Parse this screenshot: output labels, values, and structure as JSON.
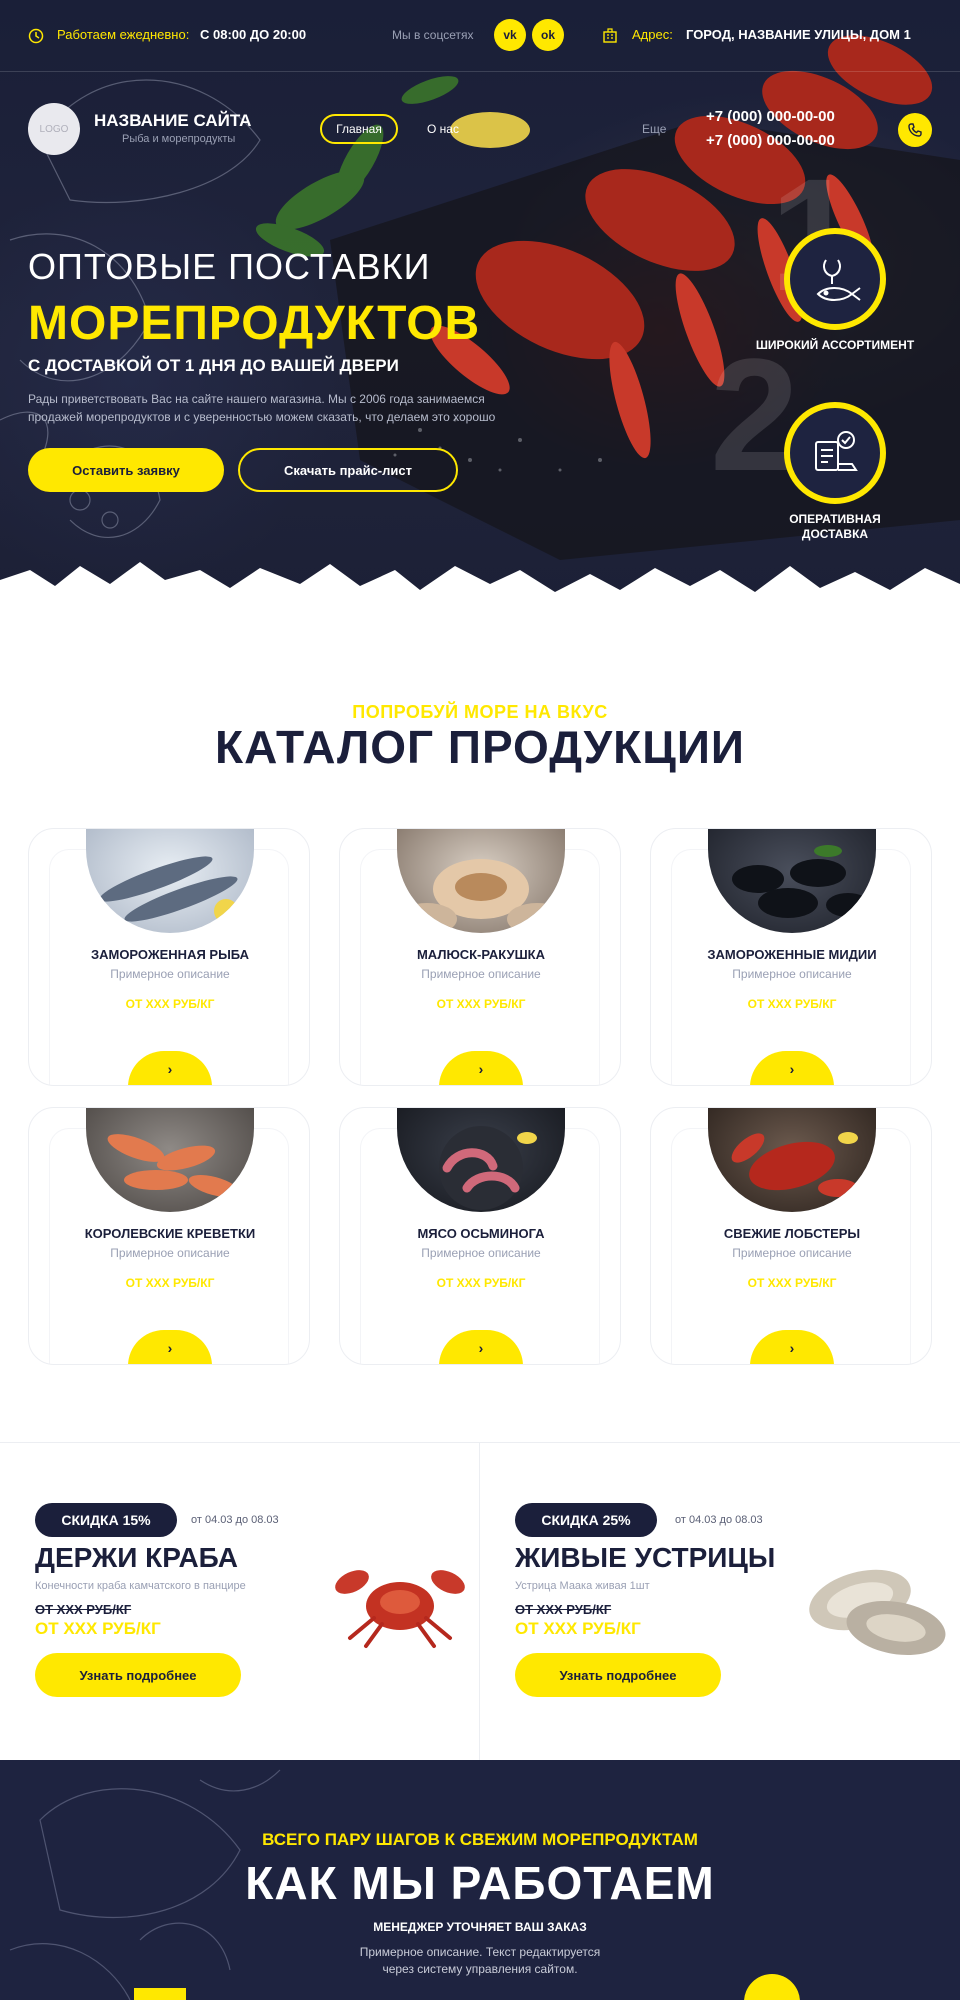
{
  "topbar": {
    "hours_label": "Работаем ежедневно:",
    "hours_value": "С 08:00 ДО 20:00",
    "social_label": "Мы в соцсетях",
    "social_vk": "vk",
    "social_ok": "ok",
    "address_label": "Адрес:",
    "address_value": "ГОРОД, НАЗВАНИЕ УЛИЦЫ, ДОМ 1"
  },
  "header": {
    "logo_text": "LOGO",
    "site_name": "НАЗВАНИЕ САЙТА",
    "site_tagline": "Рыба и морепродукты",
    "nav": [
      "Главная",
      "О нас",
      "Еще"
    ],
    "phones": [
      "+7 (000) 000-00-00",
      "+7 (000) 000-00-00"
    ]
  },
  "hero": {
    "line1": "ОПТОВЫЕ ПОСТАВКИ",
    "line2": "МОРЕПРОДУКТОВ",
    "line3": "С ДОСТАВКОЙ ОТ 1 ДНЯ ДО ВАШЕЙ ДВЕРИ",
    "desc_line1": "Рады приветствовать Вас на сайте нашего магазина. Мы с 2006 года занимаемся",
    "desc_line2": "продажей морепродуктов и с уверенностью можем сказать, что делаем это хорошо",
    "btn_primary": "Оставить заявку",
    "btn_secondary": "Скачать прайс-лист",
    "feature1": "ШИРОКИЙ АССОРТИМЕНТ",
    "feature2": "ОПЕРАТИВНАЯ ДОСТАВКА",
    "feature_numbers": [
      "1",
      "2"
    ]
  },
  "catalog": {
    "subtitle": "ПОПРОБУЙ МОРЕ НА ВКУС",
    "title": "КАТАЛОГ ПРОДУКЦИИ",
    "items": [
      {
        "name": "ЗАМОРОЖЕННАЯ РЫБА",
        "desc": "Примерное описание",
        "price": "ОТ XXX РУБ/КГ",
        "arrow": "›"
      },
      {
        "name": "МАЛЮСК-РАКУШКА",
        "desc": "Примерное описание",
        "price": "ОТ XXX РУБ/КГ",
        "arrow": "›"
      },
      {
        "name": "ЗАМОРОЖЕННЫЕ МИДИИ",
        "desc": "Примерное описание",
        "price": "ОТ XXX РУБ/КГ",
        "arrow": "›"
      },
      {
        "name": "КОРОЛЕВСКИЕ КРЕВЕТКИ",
        "desc": "Примерное описание",
        "price": "ОТ XXX РУБ/КГ",
        "arrow": "›"
      },
      {
        "name": "МЯСО ОСЬМИНОГА",
        "desc": "Примерное описание",
        "price": "ОТ XXX РУБ/КГ",
        "arrow": "›"
      },
      {
        "name": "СВЕЖИЕ ЛОБСТЕРЫ",
        "desc": "Примерное описание",
        "price": "ОТ XXX РУБ/КГ",
        "arrow": "›"
      }
    ]
  },
  "promos": [
    {
      "badge": "СКИДКА 15%",
      "dates": "от 04.03 до 08.03",
      "title": "ДЕРЖИ КРАБА",
      "desc": "Конечности краба камчатского в панцире",
      "old_price": "ОТ XXX РУБ/КГ",
      "new_price": "ОТ XXX РУБ/КГ",
      "button": "Узнать подробнее"
    },
    {
      "badge": "СКИДКА 25%",
      "dates": "от 04.03 до 08.03",
      "title": "ЖИВЫЕ УСТРИЦЫ",
      "desc": "Устрица Маака живая 1шт",
      "old_price": "ОТ XXX РУБ/КГ",
      "new_price": "ОТ XXX РУБ/КГ",
      "button": "Узнать подробнее"
    }
  ],
  "work": {
    "subtitle": "ВСЕГО ПАРУ ШАГОВ К СВЕЖИМ МОРЕПРОДУКТАМ",
    "title": "КАК МЫ РАБОТАЕМ",
    "step_title": "МЕНЕДЖЕР УТОЧНЯЕТ ВАШ ЗАКАЗ",
    "step_desc_line1": "Примерное описание. Текст редактируется",
    "step_desc_line2": "через систему управления сайтом."
  },
  "colors": {
    "accent": "#ffe800",
    "dark": "#1b1f3b",
    "navy": "#1e2340",
    "muted": "#9aa0b4"
  }
}
